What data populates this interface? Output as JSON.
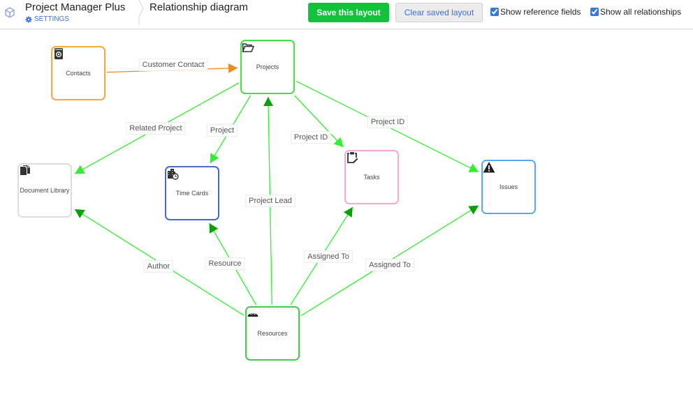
{
  "header": {
    "app_title": "Project Manager Plus",
    "settings_label": "SETTINGS",
    "page_title": "Relationship diagram",
    "save_label": "Save this layout",
    "clear_label": "Clear saved layout",
    "show_reference_fields": {
      "label": "Show reference fields",
      "checked": true
    },
    "show_all_relationships": {
      "label": "Show all relationships",
      "checked": true
    }
  },
  "colors": {
    "save_button": "#12c23a",
    "edge_light": "#33ee33",
    "edge_dark": "#00a300",
    "edge_orange": "#f28a1a"
  },
  "nodes": [
    {
      "id": "contacts",
      "label": "Contacts",
      "icon": "address-book-icon",
      "border": "#f4a93b"
    },
    {
      "id": "projects",
      "label": "Projects",
      "icon": "folder-open-icon",
      "border": "#45e045"
    },
    {
      "id": "doclib",
      "label": "Document Library",
      "icon": "documents-icon",
      "border": "#dddddd"
    },
    {
      "id": "timecards",
      "label": "Time Cards",
      "icon": "building-clock-icon",
      "border": "#4a68c4"
    },
    {
      "id": "tasks",
      "label": "Tasks",
      "icon": "clipboard-edit-icon",
      "border": "#f7a9d6"
    },
    {
      "id": "issues",
      "label": "Issues",
      "icon": "warning-icon",
      "border": "#5aa8f5"
    },
    {
      "id": "resources",
      "label": "Resources",
      "icon": "bread-icon",
      "border": "#45cc45"
    }
  ],
  "edges": [
    {
      "from": "contacts",
      "to": "projects",
      "label": "Customer Contact",
      "style": "orange"
    },
    {
      "from": "projects",
      "to": "doclib",
      "label": "Related Project",
      "style": "light"
    },
    {
      "from": "projects",
      "to": "timecards",
      "label": "Project",
      "style": "light"
    },
    {
      "from": "projects",
      "to": "tasks",
      "label": "Project ID",
      "style": "light"
    },
    {
      "from": "projects",
      "to": "issues",
      "label": "Project ID",
      "style": "light"
    },
    {
      "from": "resources",
      "to": "projects",
      "label": "Project Lead",
      "style": "dark"
    },
    {
      "from": "resources",
      "to": "doclib",
      "label": "Author",
      "style": "dark"
    },
    {
      "from": "resources",
      "to": "timecards",
      "label": "Resource",
      "style": "dark"
    },
    {
      "from": "resources",
      "to": "tasks",
      "label": "Assigned To",
      "style": "dark"
    },
    {
      "from": "resources",
      "to": "issues",
      "label": "Assigned To",
      "style": "dark"
    }
  ]
}
